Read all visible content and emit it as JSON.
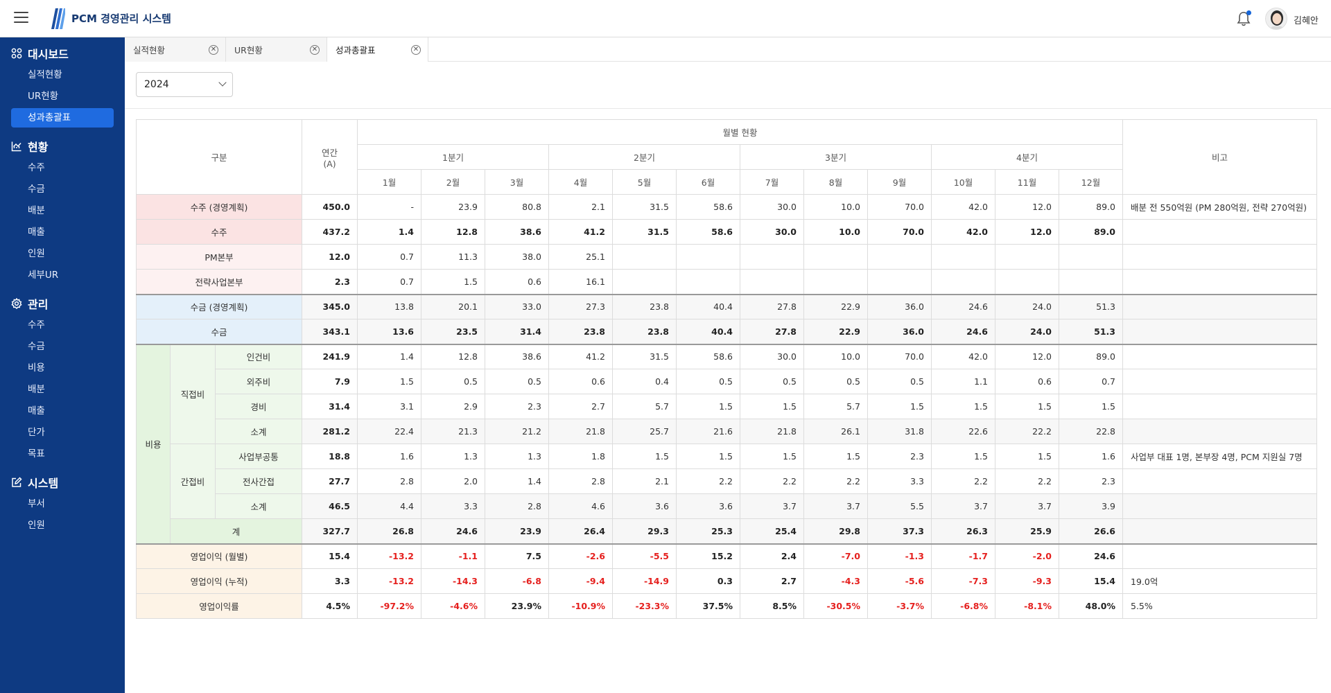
{
  "header": {
    "title": "PCM 경영관리 시스템",
    "user_name": "김혜안",
    "menu_icon": "hamburger-icon",
    "notification_icon": "bell-icon"
  },
  "sidebar": {
    "sections": [
      {
        "title": "대시보드",
        "icon": "dashboard-icon",
        "items": [
          "실적현황",
          "UR현황",
          "성과총괄표"
        ],
        "active": "성과총괄표"
      },
      {
        "title": "현황",
        "icon": "chart-icon",
        "items": [
          "수주",
          "수금",
          "배분",
          "매출",
          "인원",
          "세부UR"
        ]
      },
      {
        "title": "관리",
        "icon": "gear-icon",
        "items": [
          "수주",
          "수금",
          "비용",
          "배분",
          "매출",
          "단가",
          "목표"
        ]
      },
      {
        "title": "시스템",
        "icon": "edit-icon",
        "items": [
          "부서",
          "인원"
        ]
      }
    ]
  },
  "tabs": [
    {
      "label": "실적현황",
      "active": false
    },
    {
      "label": "UR현황",
      "active": false
    },
    {
      "label": "성과총괄표",
      "active": true
    }
  ],
  "year_select": {
    "value": "2024"
  },
  "table": {
    "headers": {
      "category": "구분",
      "annual": "연간\n(A)",
      "monthly": "월별 현황",
      "quarters": [
        "1분기",
        "2분기",
        "3분기",
        "4분기"
      ],
      "months": [
        "1월",
        "2월",
        "3월",
        "4월",
        "5월",
        "6월",
        "7월",
        "8월",
        "9월",
        "10월",
        "11월",
        "12월"
      ],
      "note": "비고"
    },
    "group_labels": {
      "cost": "비용",
      "direct": "직접비",
      "indirect": "간접비"
    },
    "rows": [
      {
        "key": "order_plan",
        "label": "수주 (경영계획)",
        "annual": "450.0",
        "months": [
          "-",
          "23.9",
          "80.8",
          "2.1",
          "31.5",
          "58.6",
          "30.0",
          "10.0",
          "70.0",
          "42.0",
          "12.0",
          "89.0"
        ],
        "note": "배분 전 550억원 (PM 280억원, 전략 270억원)"
      },
      {
        "key": "order",
        "label": "수주",
        "annual": "437.2",
        "months": [
          "1.4",
          "12.8",
          "38.6",
          "41.2",
          "31.5",
          "58.6",
          "30.0",
          "10.0",
          "70.0",
          "42.0",
          "12.0",
          "89.0"
        ],
        "note": ""
      },
      {
        "key": "pm",
        "label": "PM본부",
        "annual": "12.0",
        "months": [
          "0.7",
          "11.3",
          "38.0",
          "25.1",
          "",
          "",
          "",
          "",
          "",
          "",
          "",
          ""
        ],
        "note": ""
      },
      {
        "key": "strategy",
        "label": "전략사업본부",
        "annual": "2.3",
        "months": [
          "0.7",
          "1.5",
          "0.6",
          "16.1",
          "",
          "",
          "",
          "",
          "",
          "",
          "",
          ""
        ],
        "note": ""
      },
      {
        "key": "collect_plan",
        "label": "수금 (경영계획)",
        "annual": "345.0",
        "months": [
          "13.8",
          "20.1",
          "33.0",
          "27.3",
          "23.8",
          "40.4",
          "27.8",
          "22.9",
          "36.0",
          "24.6",
          "24.0",
          "51.3"
        ],
        "note": ""
      },
      {
        "key": "collect",
        "label": "수금",
        "annual": "343.1",
        "months": [
          "13.6",
          "23.5",
          "31.4",
          "23.8",
          "23.8",
          "40.4",
          "27.8",
          "22.9",
          "36.0",
          "24.6",
          "24.0",
          "51.3"
        ],
        "note": ""
      },
      {
        "key": "labor",
        "label": "인건비",
        "annual": "241.9",
        "months": [
          "1.4",
          "12.8",
          "38.6",
          "41.2",
          "31.5",
          "58.6",
          "30.0",
          "10.0",
          "70.0",
          "42.0",
          "12.0",
          "89.0"
        ],
        "note": ""
      },
      {
        "key": "outsource",
        "label": "외주비",
        "annual": "7.9",
        "months": [
          "1.5",
          "0.5",
          "0.5",
          "0.6",
          "0.4",
          "0.5",
          "0.5",
          "0.5",
          "0.5",
          "1.1",
          "0.6",
          "0.7"
        ],
        "note": ""
      },
      {
        "key": "expense",
        "label": "경비",
        "annual": "31.4",
        "months": [
          "3.1",
          "2.9",
          "2.3",
          "2.7",
          "5.7",
          "1.5",
          "1.5",
          "5.7",
          "1.5",
          "1.5",
          "1.5",
          "1.5"
        ],
        "note": ""
      },
      {
        "key": "direct_sub",
        "label": "소계",
        "annual": "281.2",
        "months": [
          "22.4",
          "21.3",
          "21.2",
          "21.8",
          "25.7",
          "21.6",
          "21.8",
          "26.1",
          "31.8",
          "22.6",
          "22.2",
          "22.8"
        ],
        "note": ""
      },
      {
        "key": "biz_common",
        "label": "사업부공통",
        "annual": "18.8",
        "months": [
          "1.6",
          "1.3",
          "1.3",
          "1.8",
          "1.5",
          "1.5",
          "1.5",
          "1.5",
          "2.3",
          "1.5",
          "1.5",
          "1.6"
        ],
        "note": "사업부 대표 1명, 본부장 4명, PCM 지원실 7명"
      },
      {
        "key": "corp_indirect",
        "label": "전사간접",
        "annual": "27.7",
        "months": [
          "2.8",
          "2.0",
          "1.4",
          "2.8",
          "2.1",
          "2.2",
          "2.2",
          "2.2",
          "3.3",
          "2.2",
          "2.2",
          "2.3"
        ],
        "note": ""
      },
      {
        "key": "indirect_sub",
        "label": "소계",
        "annual": "46.5",
        "months": [
          "4.4",
          "3.3",
          "2.8",
          "4.6",
          "3.6",
          "3.6",
          "3.7",
          "3.7",
          "5.5",
          "3.7",
          "3.7",
          "3.9"
        ],
        "note": ""
      },
      {
        "key": "cost_total",
        "label": "계",
        "annual": "327.7",
        "months": [
          "26.8",
          "24.6",
          "23.9",
          "26.4",
          "29.3",
          "25.3",
          "25.4",
          "29.8",
          "37.3",
          "26.3",
          "25.9",
          "26.6"
        ],
        "note": ""
      },
      {
        "key": "op_monthly",
        "label": "영업이익 (월별)",
        "annual": "15.4",
        "months": [
          "-13.2",
          "-1.1",
          "7.5",
          "-2.6",
          "-5.5",
          "15.2",
          "2.4",
          "-7.0",
          "-1.3",
          "-1.7",
          "-2.0",
          "24.6"
        ],
        "note": ""
      },
      {
        "key": "op_cumulative",
        "label": "영업이익 (누적)",
        "annual": "3.3",
        "months": [
          "-13.2",
          "-14.3",
          "-6.8",
          "-9.4",
          "-14.9",
          "0.3",
          "2.7",
          "-4.3",
          "-5.6",
          "-7.3",
          "-9.3",
          "15.4"
        ],
        "note": "19.0억"
      },
      {
        "key": "op_margin",
        "label": "영업이익률",
        "annual": "4.5%",
        "months": [
          "-97.2%",
          "-4.6%",
          "23.9%",
          "-10.9%",
          "-23.3%",
          "37.5%",
          "8.5%",
          "-30.5%",
          "-3.7%",
          "-6.8%",
          "-8.1%",
          "48.0%"
        ],
        "note": "5.5%"
      }
    ]
  }
}
